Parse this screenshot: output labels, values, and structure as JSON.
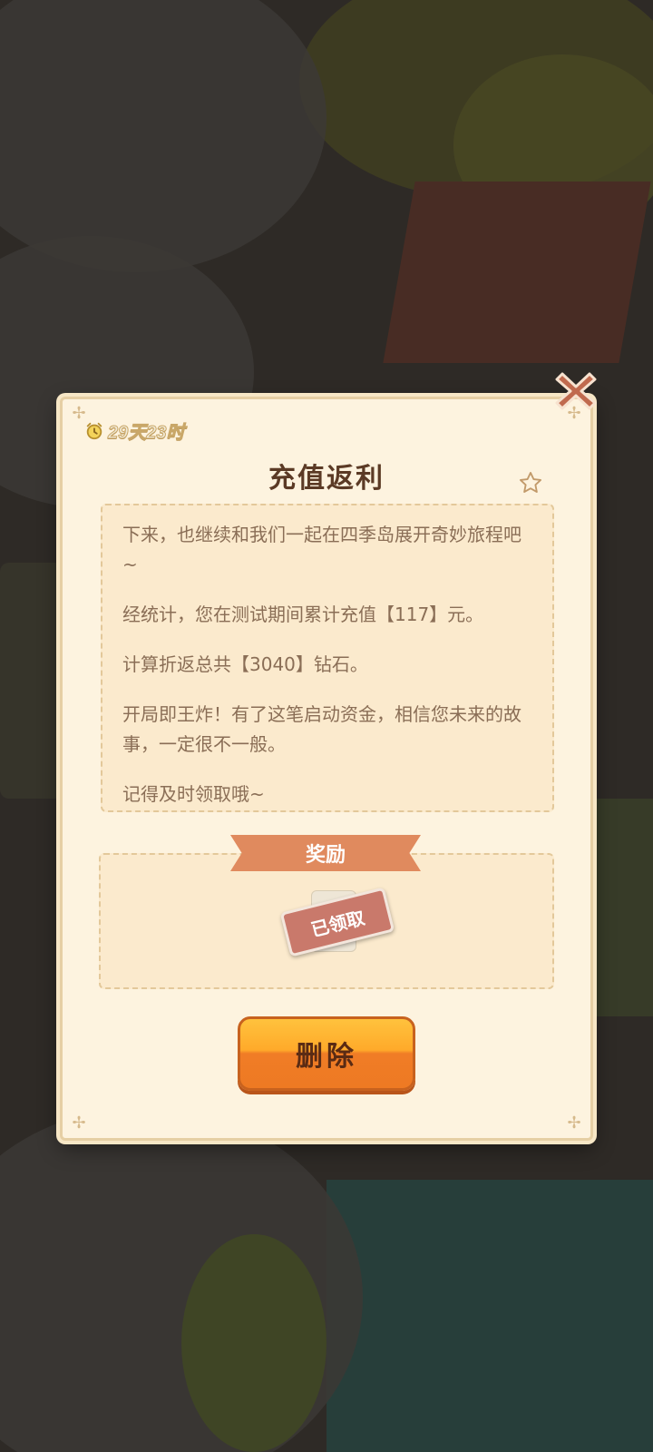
{
  "dialog": {
    "timer_text": "29天23时",
    "title": "充值返利",
    "message_paragraphs": [
      "下来，也继续和我们一起在四季岛展开奇妙旅程吧~",
      "经统计，您在测试期间累计充值【117】元。",
      "计算折返总共【3040】钻石。",
      "开局即王炸！有了这笔启动资金，相信您未来的故事，一定很不一般。",
      "记得及时领取哦~"
    ],
    "reward_label": "奖励",
    "claimed_label": "已领取",
    "delete_label": "删除"
  },
  "icons": {
    "close": "close-icon",
    "timer": "alarm-clock-icon",
    "star": "star-icon"
  },
  "colors": {
    "panel_bg": "#fdf3df",
    "title": "#5b3a25",
    "body_text": "#8a6e56",
    "ribbon": "#e08a5e",
    "button_orange": "#ffaa2a",
    "close_icon": "#c06a4e"
  }
}
